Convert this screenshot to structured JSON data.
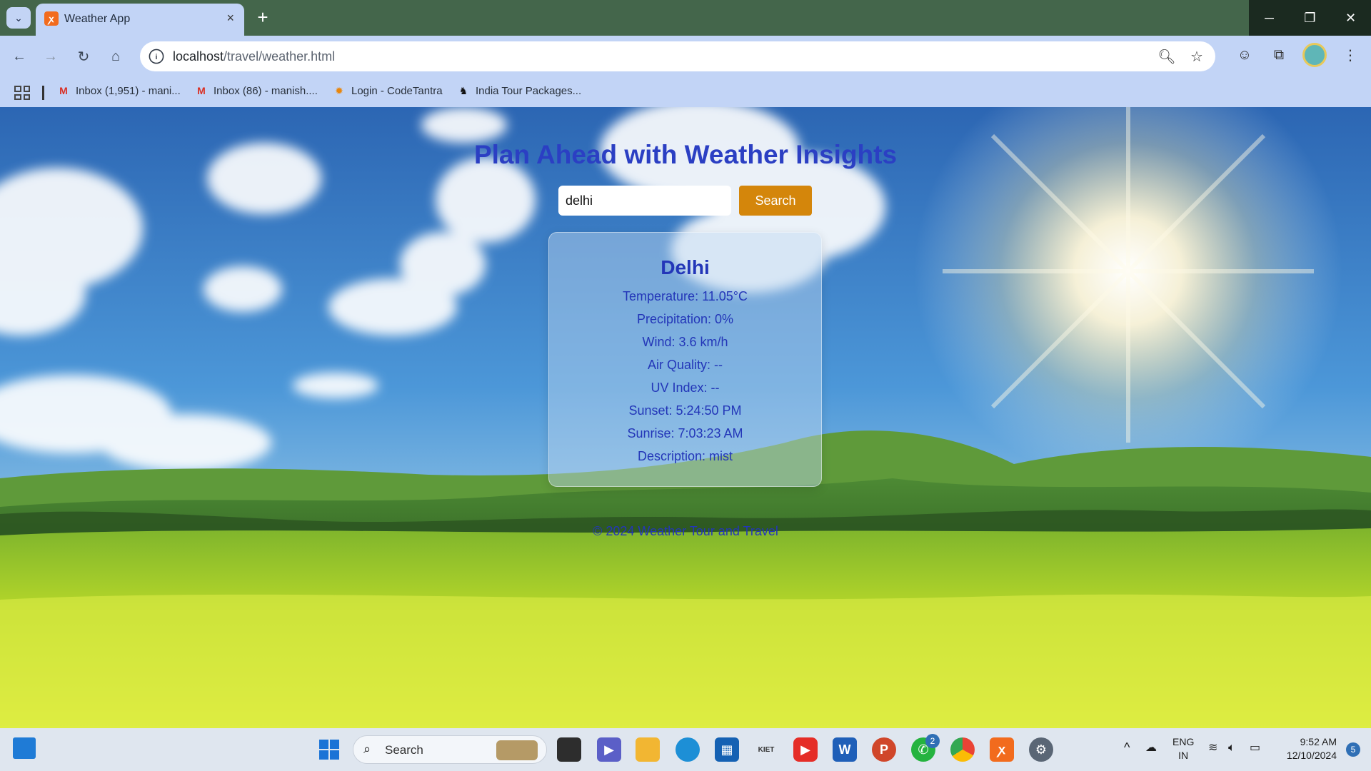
{
  "browser": {
    "tab_title": "Weather App",
    "tab_close": "×",
    "new_tab": "+",
    "url_host": "localhost",
    "url_path": "/travel/weather.html",
    "window_minimize": "─",
    "window_restore": "❐",
    "window_close": "✕"
  },
  "bookmarks": [
    {
      "label": "Inbox (1,951) - mani...",
      "icon": "gmail-icon"
    },
    {
      "label": "Inbox (86) - manish....",
      "icon": "gmail-icon"
    },
    {
      "label": "Login - CodeTantra",
      "icon": "codetantra-icon"
    },
    {
      "label": "India Tour Packages...",
      "icon": "tour-icon"
    }
  ],
  "page": {
    "title": "Plan Ahead with Weather Insights",
    "search": {
      "value": "delhi",
      "button_label": "Search"
    },
    "weather": {
      "city": "Delhi",
      "temperature": "Temperature: 11.05°C",
      "precipitation": "Precipitation: 0%",
      "wind": "Wind: 3.6 km/h",
      "air_quality": "Air Quality: --",
      "uv_index": "UV Index: --",
      "sunset": "Sunset: 5:24:50 PM",
      "sunrise": "Sunrise: 7:03:23 AM",
      "description": "Description: mist"
    },
    "footer": "© 2024 Weather Tour and Travel"
  },
  "taskbar": {
    "search_label": "Search",
    "language": "ENG",
    "region": "IN",
    "time": "9:52 AM",
    "date": "12/10/2024",
    "notification_count": "5",
    "whatsapp_badge": "2"
  },
  "colors": {
    "title": "#2b3fc3",
    "text": "#2336b8",
    "search_button": "#d4860b",
    "sky_top": "#2f6fb8",
    "grass": "#c8dc2a"
  }
}
